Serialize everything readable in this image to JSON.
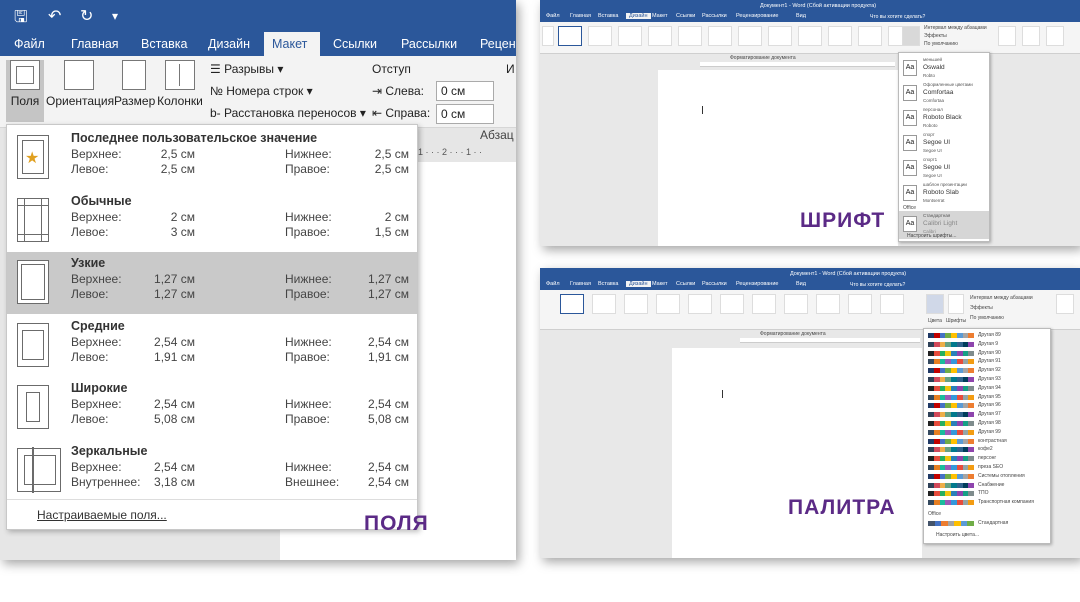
{
  "margins_panel": {
    "tabs": [
      "Файл",
      "Главная",
      "Вставка",
      "Дизайн",
      "Макет",
      "Ссылки",
      "Рассылки",
      "Рецензи"
    ],
    "active_tab": "Макет",
    "ribbon": {
      "margins_label": "Поля",
      "orientation_label": "Ориентация",
      "size_label": "Размер",
      "columns_label": "Колонки",
      "breaks_label": "Разрывы",
      "line_numbers_label": "Номера строк",
      "hyphenation_label": "Расстановка переносов",
      "indent_title": "Отступ",
      "left_label": "Слева:",
      "left_value": "0 см",
      "right_label": "Справа:",
      "right_value": "0 см",
      "paragraph_group": "Абзац",
      "spacing_title_cut": "И"
    },
    "ruler_text": "1 · · · 2 · · · 1 · ·",
    "presets": [
      {
        "name": "Последнее пользовательское значение",
        "top_label": "Верхнее:",
        "top": "2,5 см",
        "bottom_label": "Нижнее:",
        "bottom": "2,5 см",
        "left_label": "Левое:",
        "left": "2,5 см",
        "right_label": "Правое:",
        "right": "2,5 см",
        "icon": "star-page-icon"
      },
      {
        "name": "Обычные",
        "top_label": "Верхнее:",
        "top": "2 см",
        "bottom_label": "Нижнее:",
        "bottom": "2 см",
        "left_label": "Левое:",
        "left": "3 см",
        "right_label": "Правое:",
        "right": "1,5 см",
        "icon": "normal-margins-icon"
      },
      {
        "name": "Узкие",
        "top_label": "Верхнее:",
        "top": "1,27 см",
        "bottom_label": "Нижнее:",
        "bottom": "1,27 см",
        "left_label": "Левое:",
        "left": "1,27 см",
        "right_label": "Правое:",
        "right": "1,27 см",
        "icon": "narrow-margins-icon"
      },
      {
        "name": "Средние",
        "top_label": "Верхнее:",
        "top": "2,54 см",
        "bottom_label": "Нижнее:",
        "bottom": "2,54 см",
        "left_label": "Левое:",
        "left": "1,91 см",
        "right_label": "Правое:",
        "right": "1,91 см",
        "icon": "moderate-margins-icon"
      },
      {
        "name": "Широкие",
        "top_label": "Верхнее:",
        "top": "2,54 см",
        "bottom_label": "Нижнее:",
        "bottom": "2,54 см",
        "left_label": "Левое:",
        "left": "5,08 см",
        "right_label": "Правое:",
        "right": "5,08 см",
        "icon": "wide-margins-icon"
      },
      {
        "name": "Зеркальные",
        "top_label": "Верхнее:",
        "top": "2,54 см",
        "bottom_label": "Нижнее:",
        "bottom": "2,54 см",
        "left_label": "Внутреннее:",
        "left": "3,18 см",
        "right_label": "Внешнее:",
        "right": "2,54 см",
        "icon": "mirrored-margins-icon"
      }
    ],
    "custom_margins": "Настраиваемые поля...",
    "caption": "ПОЛЯ"
  },
  "font_panel": {
    "title": "Документ1 - Word (Сбой активации продукта)",
    "tabs": [
      "Файл",
      "Главная",
      "Вставка",
      "Дизайн",
      "Макет",
      "Ссылки",
      "Рассылки",
      "Рецензирование",
      "Вид"
    ],
    "active_tab": "Дизайн",
    "search": "Что вы хотите сделать?",
    "ribbon_right": [
      "Интервал между абзацами",
      "Эффекты",
      "По умолчанию"
    ],
    "group_caption": "Форматирование документа",
    "fonts": [
      {
        "head": "меньшей",
        "main": "Oswald",
        "sub": "Robto"
      },
      {
        "head": "Оформленные цветами",
        "main": "Comfortaa",
        "sub": "Comfortaa"
      },
      {
        "head": "персонал",
        "main": "Roboto Black",
        "sub": "Roboto"
      },
      {
        "head": "спорт",
        "main": "Segoe UI",
        "sub": "Segoe UI"
      },
      {
        "head": "спорт1",
        "main": "Segoe UI",
        "sub": "Segoe UI"
      },
      {
        "head": "шаблон презентации",
        "main": "Roboto Slab",
        "sub": "Montserrat"
      }
    ],
    "office_label": "Office",
    "office_font": {
      "head": "Стандартная",
      "main": "Calibri Light",
      "sub": "Calibri"
    },
    "customize": "Настроить шрифты...",
    "caption": "ШРИФТ"
  },
  "palette_panel": {
    "title": "Документ1 - Word (Сбой активации продукта)",
    "tabs": [
      "Файл",
      "Главная",
      "Вставка",
      "Дизайн",
      "Макет",
      "Ссылки",
      "Рассылки",
      "Рецензирование",
      "Вид"
    ],
    "active_tab": "Дизайн",
    "search": "Что вы хотите сделать?",
    "ribbon_right": [
      "Интервал между абзацами",
      "Эффекты",
      "По умолчанию"
    ],
    "group_caption": "Форматирование документа",
    "colors_label": "Цвета",
    "fonts_label": "Шрифты",
    "palettes": [
      "Другая 89",
      "Другая 9",
      "Другая 90",
      "Другая 91",
      "Другая 92",
      "Другая 93",
      "Другая 94",
      "Другая 95",
      "Другая 96",
      "Другая 97",
      "Другая 98",
      "Другая 99",
      "контрастная",
      "кофе2",
      "персонг",
      "преза SEO",
      "Системы отопления",
      "Снабжение",
      "ТПО",
      "Транспортная компания"
    ],
    "office_label": "Office",
    "office_palette": "Стандартная",
    "customize": "Настроить цвета...",
    "caption": "ПАЛИТРА"
  }
}
